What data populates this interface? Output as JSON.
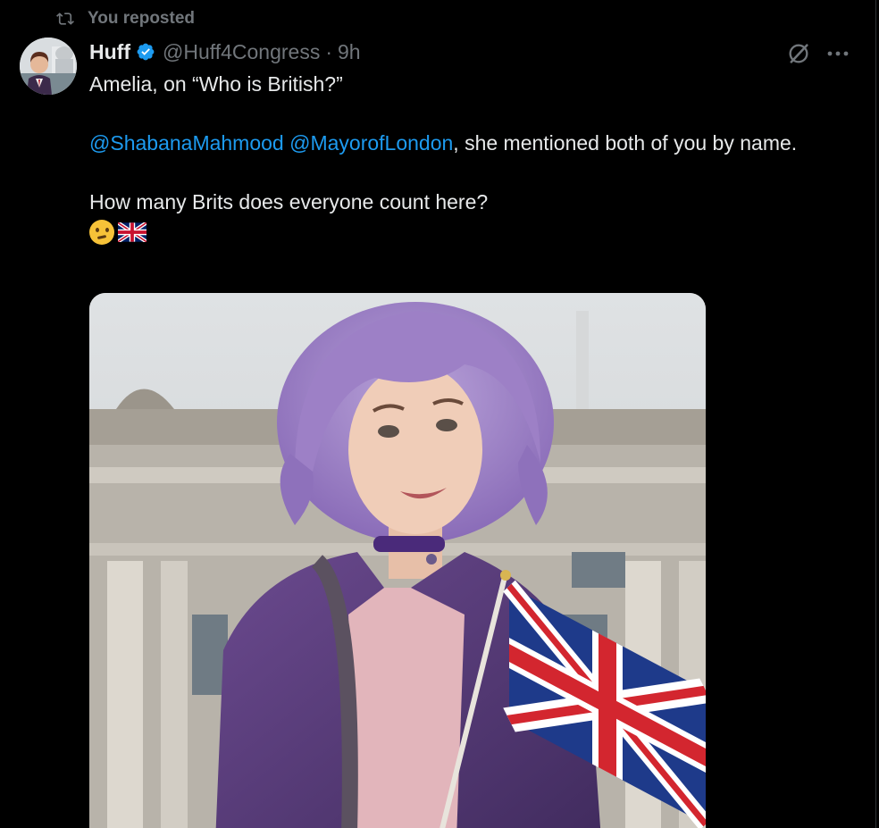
{
  "repost": {
    "label": "You reposted",
    "icon": "repost-icon"
  },
  "tweet": {
    "author": {
      "display_name": "Huff",
      "handle": "@Huff4Congress",
      "verified": true,
      "verified_color": "#1d9bf0"
    },
    "separator": "·",
    "time": "9h",
    "text": {
      "line1": "Amelia, on “Who is British?”",
      "mention1": "@ShabanaMahmood",
      "mention2": "@MayorofLondon",
      "line2_rest": ", she mentioned both of you by name.",
      "line3": "How many Brits does everyone count here?",
      "emojis": [
        "thinking-face",
        "uk-flag"
      ]
    },
    "media": {
      "type": "image",
      "icon": "image"
    }
  },
  "colors": {
    "background": "#000000",
    "text": "#e7e9ea",
    "secondary": "#71767b",
    "link": "#1d9bf0"
  }
}
